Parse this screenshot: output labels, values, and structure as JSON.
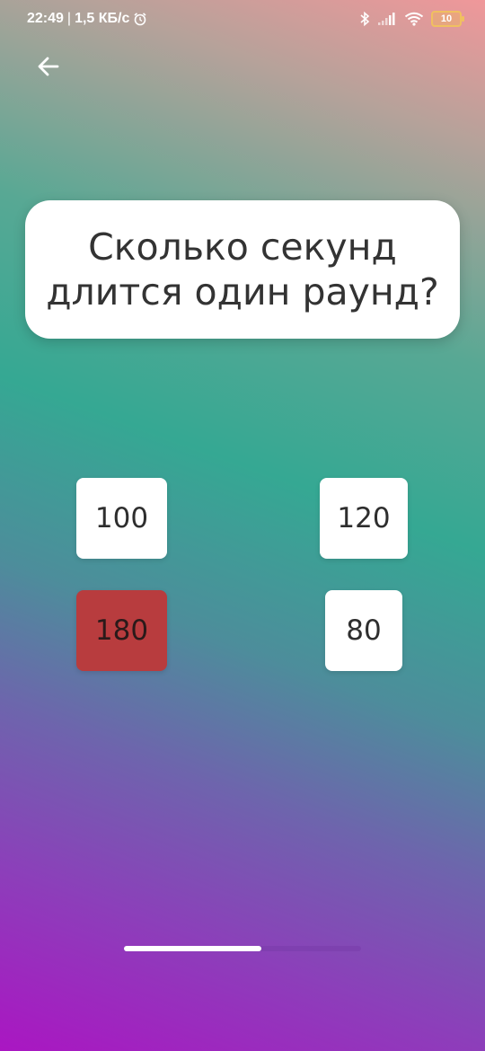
{
  "status_bar": {
    "time": "22:49",
    "separator": "|",
    "network_speed": "1,5 КБ/с",
    "alarm_icon": "alarm-clock-icon",
    "bluetooth_icon": "bluetooth-icon",
    "signal_icon": "cellular-signal-icon",
    "wifi_icon": "wifi-icon",
    "battery_level": "10"
  },
  "header": {
    "back_icon": "arrow-left-icon"
  },
  "question": {
    "text_line1": "Сколько секунд",
    "text_line2": "длится один раунд?"
  },
  "answers": [
    {
      "label": "100",
      "state": "default"
    },
    {
      "label": "120",
      "state": "default"
    },
    {
      "label": "180",
      "state": "wrong"
    },
    {
      "label": "80",
      "state": "default"
    }
  ],
  "progress": {
    "fraction": 0.58
  },
  "colors": {
    "card_background": "#ffffff",
    "wrong_answer": "#b83c3e",
    "text_dark": "#333333",
    "progress_fill": "#ffffff"
  }
}
